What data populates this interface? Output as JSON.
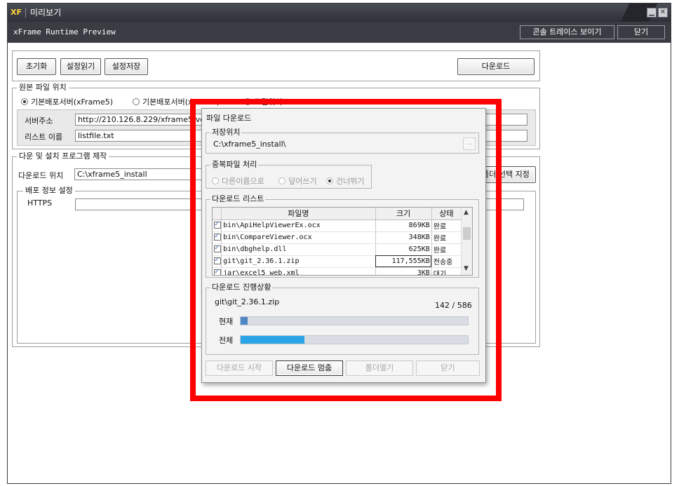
{
  "window": {
    "title": "미리보기",
    "app_icon": "XF",
    "subtitle": "xFrame Runtime Preview",
    "console_button": "콘솔 트레이스 보이기",
    "close_button": "닫기"
  },
  "toolbar": {
    "reset": "초기화",
    "load": "설정읽기",
    "save": "설정저장",
    "download": "다운로드"
  },
  "source": {
    "legend": "원본 파일 위치",
    "radio1": "기본배포서버(xFrame5)",
    "radio2": "기본배포서버(xFrame)",
    "radio3": "로컬위치",
    "server_label": "서버주소",
    "server_value": "http://210.126.8.229/xframe5/version",
    "list_label": "리스트 이름",
    "list_value": "listfile.txt"
  },
  "installer": {
    "legend": "다운 및 설치 프로그램 제작",
    "dl_label": "다운로드 위치",
    "dl_value": "C:\\xframe5_install",
    "folder_button": "폴더 선택 지정",
    "deploy_legend": "배포 정보 설정",
    "https_label": "HTTPS"
  },
  "dialog": {
    "title": "파일 다운로드",
    "save_legend": "저장위치",
    "save_path": "C:\\xframe5_install\\",
    "browse": "...",
    "dup_legend": "중복파일 처리",
    "dup_opt1": "다른이름으로",
    "dup_opt2": "덮어쓰기",
    "dup_opt3": "건너뛰기",
    "list_legend": "다운로드 리스트",
    "columns": {
      "name": "파일명",
      "size": "크기",
      "status": "상태"
    },
    "files": [
      {
        "name": "bin\\ApiHelpViewerEx.ocx",
        "size": "869KB",
        "status": "완료"
      },
      {
        "name": "bin\\CompareViewer.ocx",
        "size": "348KB",
        "status": "완료"
      },
      {
        "name": "bin\\dbghelp.dll",
        "size": "625KB",
        "status": "완료"
      },
      {
        "name": "git\\git_2.36.1.zip",
        "size": "117,555KB",
        "status": "전송중"
      },
      {
        "name": "jar\\excel5_web.xml",
        "size": "3KB",
        "status": "대기"
      }
    ],
    "progress_legend": "다운로드 진행상황",
    "current_file": "git\\git_2.36.1.zip",
    "count": "142 / 586",
    "current_label": "현재",
    "total_label": "전체",
    "current_progress": 0.03,
    "total_progress": 0.28,
    "btn_start": "다운로드 시작",
    "btn_stop": "다운로드 멈춤",
    "btn_open": "폴더열기",
    "btn_close": "닫기"
  },
  "colors": {
    "highlight_border": "#ff0000",
    "progress_current": "#4f86c6",
    "progress_total": "#2aa4e6"
  }
}
